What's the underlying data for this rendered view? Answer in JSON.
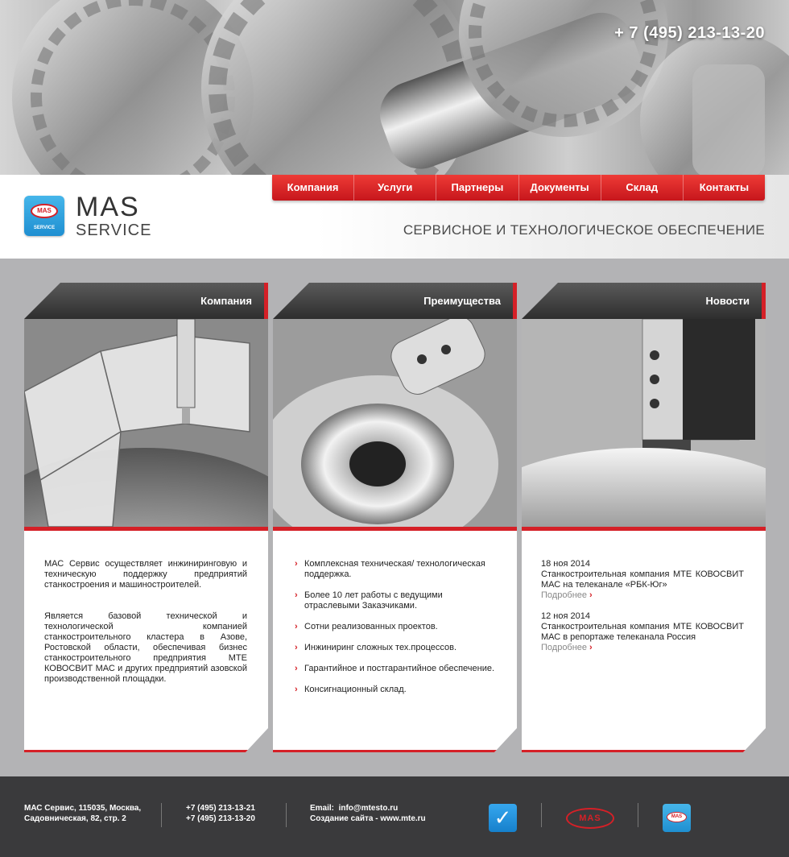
{
  "header": {
    "phone": "+ 7 (495) 213-13-20",
    "tagline": "СЕРВИСНОЕ И ТЕХНОЛОГИЧЕСКОЕ ОБЕСПЕЧЕНИЕ",
    "logo": {
      "title": "MAS",
      "subtitle": "SERVICE",
      "badge_text": "MAS",
      "badge_sub": "SERVICE"
    }
  },
  "nav": [
    {
      "label": "Компания"
    },
    {
      "label": "Услуги"
    },
    {
      "label": "Партнеры"
    },
    {
      "label": "Документы"
    },
    {
      "label": "Склад"
    },
    {
      "label": "Контакты"
    }
  ],
  "cards": {
    "company": {
      "title": "Компания",
      "paragraphs": [
        "МАС Сервис осуществляет инжиниринговую и техническую поддержку предприятий станкостроения и машиностроителей.",
        "Является базовой технической и технологической компанией станкостроительного кластера в Азове, Ростовской области, обеспечивая бизнес станкостроительного предприятия МТЕ КОВОСВИТ МАС и других предприятий азовской производственной площадки."
      ]
    },
    "advantages": {
      "title": "Преимущества",
      "items": [
        "Комплексная техническая/ технологическая поддержка.",
        "Более 10 лет работы с ведущими отраслевыми Заказчиками.",
        "Сотни реализованных проектов.",
        "Инжиниринг сложных тех.процессов.",
        "Гарантийное и постгарантийное обеспечение.",
        "Консигнационный склад."
      ]
    },
    "news": {
      "title": "Новости",
      "items": [
        {
          "date": "18 ноя 2014",
          "text": "Станкостроительная компания МТЕ КОВОСВИТ МАС на телеканале «РБК-Юг»",
          "more": "Подробнее"
        },
        {
          "date": "12 ноя 2014",
          "text": "Станкостроительная компания МТЕ КОВОСВИТ МАС в репортаже телеканала Россия",
          "more": "Подробнее"
        }
      ]
    }
  },
  "footer": {
    "address_line1": "МАС Сервис, 115035, Москва,",
    "address_line2": "Садовническая, 82, стр. 2",
    "phone1": "+7 (495) 213-13-21",
    "phone2": "+7 (495) 213-13-20",
    "email_label": "Email:",
    "email": "info@mtesto.ru",
    "created_label": "Создание сайта -",
    "created_site": "www.mte.ru",
    "mas_logo_text": "MAS"
  },
  "colors": {
    "accent": "#d52027",
    "footer_bg": "#3a3a3c",
    "page_bg": "#b3b3b5",
    "blue_badge": "#1f8fd1"
  },
  "icons": [
    "arrow-right-icon",
    "checkmark-icon",
    "mas-logo-icon"
  ]
}
